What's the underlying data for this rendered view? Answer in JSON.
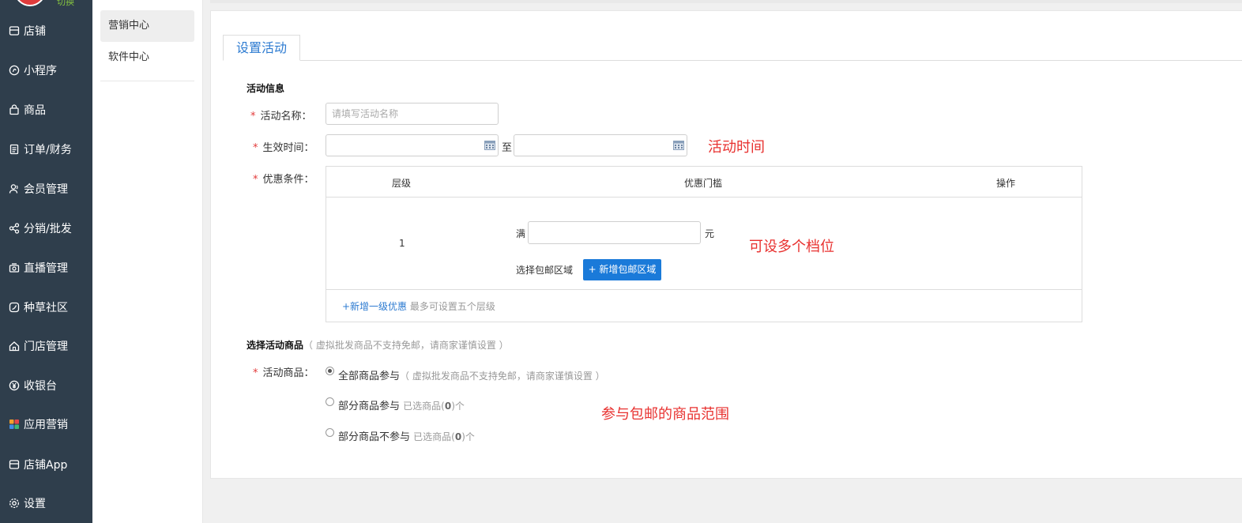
{
  "sidebar": {
    "switch_label": "切换",
    "items": [
      {
        "label": "店铺",
        "icon": "store-icon"
      },
      {
        "label": "小程序",
        "icon": "miniprogram-icon"
      },
      {
        "label": "商品",
        "icon": "bag-icon"
      },
      {
        "label": "订单/财务",
        "icon": "order-icon"
      },
      {
        "label": "会员管理",
        "icon": "members-icon"
      },
      {
        "label": "分销/批发",
        "icon": "share-icon"
      },
      {
        "label": "直播管理",
        "icon": "camera-icon"
      },
      {
        "label": "种草社区",
        "icon": "community-icon"
      },
      {
        "label": "门店管理",
        "icon": "house-icon"
      },
      {
        "label": "收银台",
        "icon": "yen-icon"
      },
      {
        "label": "应用营销",
        "icon": "apps-icon"
      },
      {
        "label": "店铺App",
        "icon": "store-app-icon"
      },
      {
        "label": "设置",
        "icon": "gear-icon"
      }
    ]
  },
  "subnav": {
    "items": [
      {
        "label": "营销中心"
      },
      {
        "label": "软件中心"
      }
    ]
  },
  "tab_label": "设置活动",
  "activity_info": {
    "heading": "活动信息",
    "name_label": "活动名称：",
    "name_placeholder": "请填写活动名称",
    "time_label": "生效时间：",
    "to_label": "至",
    "discount_label": "优惠条件："
  },
  "tier_table": {
    "headers": [
      "层级",
      "优惠门槛",
      "操作"
    ],
    "rows": [
      {
        "level": "1",
        "full_prefix": "满",
        "unit": "元",
        "region_label": "选择包邮区域",
        "add_region_button": "+ 新增包邮区域"
      }
    ],
    "add_tier_link": "+新增一级优惠",
    "add_tier_hint": "最多可设置五个层级"
  },
  "goods": {
    "heading": "选择活动商品",
    "heading_hint": "（ 虚拟批发商品不支持免邮，请商家谨慎设置 ）",
    "label": "活动商品：",
    "options": [
      {
        "label": "全部商品参与",
        "extra": "（ 虚拟批发商品不支持免邮，请商家谨慎设置 ）",
        "selected": true
      },
      {
        "label": "部分商品参与",
        "extra_prefix": "已选商品(",
        "count": "0",
        "extra_suffix": ")个",
        "selected": false
      },
      {
        "label": "部分商品不参与",
        "extra_prefix": "已选商品(",
        "count": "0",
        "extra_suffix": ")个",
        "selected": false
      }
    ]
  },
  "annotations": {
    "time_note": "活动时间",
    "tiers_note": "可设多个档位",
    "goods_note": "参与包邮的商品范围"
  },
  "colors": {
    "accent": "#1a7ad9",
    "annotation": "#e8312f",
    "sidebar": "#2f3e4c"
  }
}
